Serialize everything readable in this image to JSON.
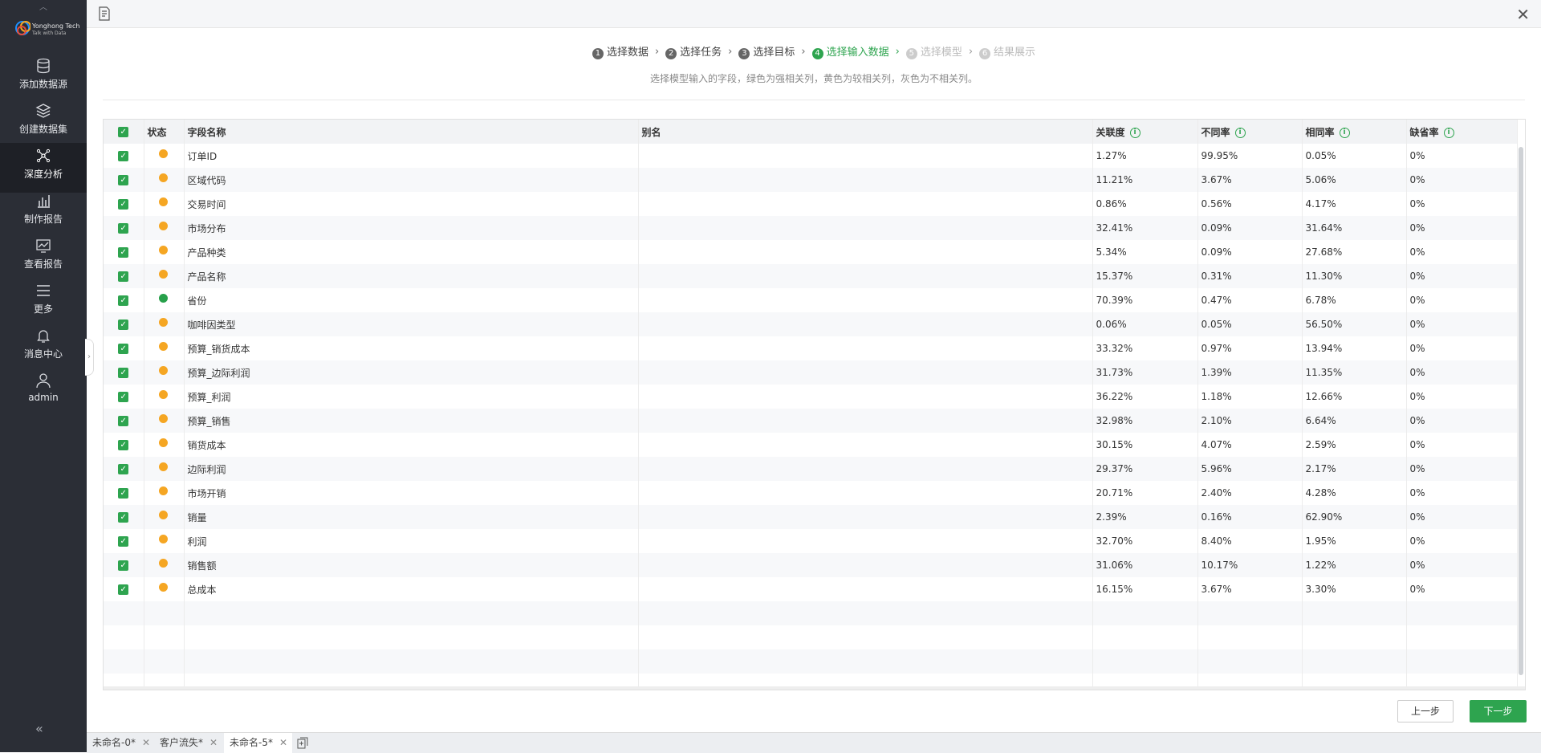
{
  "sidebar": {
    "logo_text": "Yonghong Tech",
    "logo_sub": "Talk with Data",
    "items": [
      {
        "label": "添加数据源"
      },
      {
        "label": "创建数据集"
      },
      {
        "label": "深度分析"
      },
      {
        "label": "制作报告"
      },
      {
        "label": "查看报告"
      },
      {
        "label": "更多"
      },
      {
        "label": "消息中心"
      },
      {
        "label": "admin"
      }
    ],
    "active_index": 2
  },
  "steps": [
    {
      "num": "1",
      "label": "选择数据",
      "state": "done"
    },
    {
      "num": "2",
      "label": "选择任务",
      "state": "done"
    },
    {
      "num": "3",
      "label": "选择目标",
      "state": "done"
    },
    {
      "num": "4",
      "label": "选择输入数据",
      "state": "active"
    },
    {
      "num": "5",
      "label": "选择模型",
      "state": "todo"
    },
    {
      "num": "6",
      "label": "结果展示",
      "state": "todo"
    }
  ],
  "hint": "选择模型输入的字段，绿色为强相关列，黄色为较相关列，灰色为不相关列。",
  "table": {
    "headers": {
      "status": "状态",
      "field": "字段名称",
      "alias": "别名",
      "corr": "关联度",
      "diff": "不同率",
      "same": "相同率",
      "missing": "缺省率"
    },
    "rows": [
      {
        "field": "订单ID",
        "alias": "",
        "corr": "1.27%",
        "diff": "99.95%",
        "same": "0.05%",
        "missing": "0%",
        "status": "orange"
      },
      {
        "field": "区域代码",
        "alias": "",
        "corr": "11.21%",
        "diff": "3.67%",
        "same": "5.06%",
        "missing": "0%",
        "status": "orange"
      },
      {
        "field": "交易时间",
        "alias": "",
        "corr": "0.86%",
        "diff": "0.56%",
        "same": "4.17%",
        "missing": "0%",
        "status": "orange"
      },
      {
        "field": "市场分布",
        "alias": "",
        "corr": "32.41%",
        "diff": "0.09%",
        "same": "31.64%",
        "missing": "0%",
        "status": "orange"
      },
      {
        "field": "产品种类",
        "alias": "",
        "corr": "5.34%",
        "diff": "0.09%",
        "same": "27.68%",
        "missing": "0%",
        "status": "orange"
      },
      {
        "field": "产品名称",
        "alias": "",
        "corr": "15.37%",
        "diff": "0.31%",
        "same": "11.30%",
        "missing": "0%",
        "status": "orange"
      },
      {
        "field": "省份",
        "alias": "",
        "corr": "70.39%",
        "diff": "0.47%",
        "same": "6.78%",
        "missing": "0%",
        "status": "green"
      },
      {
        "field": "咖啡因类型",
        "alias": "",
        "corr": "0.06%",
        "diff": "0.05%",
        "same": "56.50%",
        "missing": "0%",
        "status": "orange"
      },
      {
        "field": "预算_销货成本",
        "alias": "",
        "corr": "33.32%",
        "diff": "0.97%",
        "same": "13.94%",
        "missing": "0%",
        "status": "orange"
      },
      {
        "field": "预算_边际利润",
        "alias": "",
        "corr": "31.73%",
        "diff": "1.39%",
        "same": "11.35%",
        "missing": "0%",
        "status": "orange"
      },
      {
        "field": "预算_利润",
        "alias": "",
        "corr": "36.22%",
        "diff": "1.18%",
        "same": "12.66%",
        "missing": "0%",
        "status": "orange"
      },
      {
        "field": "预算_销售",
        "alias": "",
        "corr": "32.98%",
        "diff": "2.10%",
        "same": "6.64%",
        "missing": "0%",
        "status": "orange"
      },
      {
        "field": "销货成本",
        "alias": "",
        "corr": "30.15%",
        "diff": "4.07%",
        "same": "2.59%",
        "missing": "0%",
        "status": "orange"
      },
      {
        "field": "边际利润",
        "alias": "",
        "corr": "29.37%",
        "diff": "5.96%",
        "same": "2.17%",
        "missing": "0%",
        "status": "orange"
      },
      {
        "field": "市场开销",
        "alias": "",
        "corr": "20.71%",
        "diff": "2.40%",
        "same": "4.28%",
        "missing": "0%",
        "status": "orange"
      },
      {
        "field": "销量",
        "alias": "",
        "corr": "2.39%",
        "diff": "0.16%",
        "same": "62.90%",
        "missing": "0%",
        "status": "orange"
      },
      {
        "field": "利润",
        "alias": "",
        "corr": "32.70%",
        "diff": "8.40%",
        "same": "1.95%",
        "missing": "0%",
        "status": "orange"
      },
      {
        "field": "销售额",
        "alias": "",
        "corr": "31.06%",
        "diff": "10.17%",
        "same": "1.22%",
        "missing": "0%",
        "status": "orange"
      },
      {
        "field": "总成本",
        "alias": "",
        "corr": "16.15%",
        "diff": "3.67%",
        "same": "3.30%",
        "missing": "0%",
        "status": "orange"
      }
    ],
    "empty_rows": 4
  },
  "colors": {
    "accent": "#2ea44f",
    "orange": "#f5a623",
    "green": "#27a04a"
  },
  "buttons": {
    "prev": "上一步",
    "next": "下一步"
  },
  "tabs": [
    {
      "label": "未命名-0*",
      "active": false
    },
    {
      "label": "客户流失*",
      "active": false
    },
    {
      "label": "未命名-5*",
      "active": true
    }
  ]
}
